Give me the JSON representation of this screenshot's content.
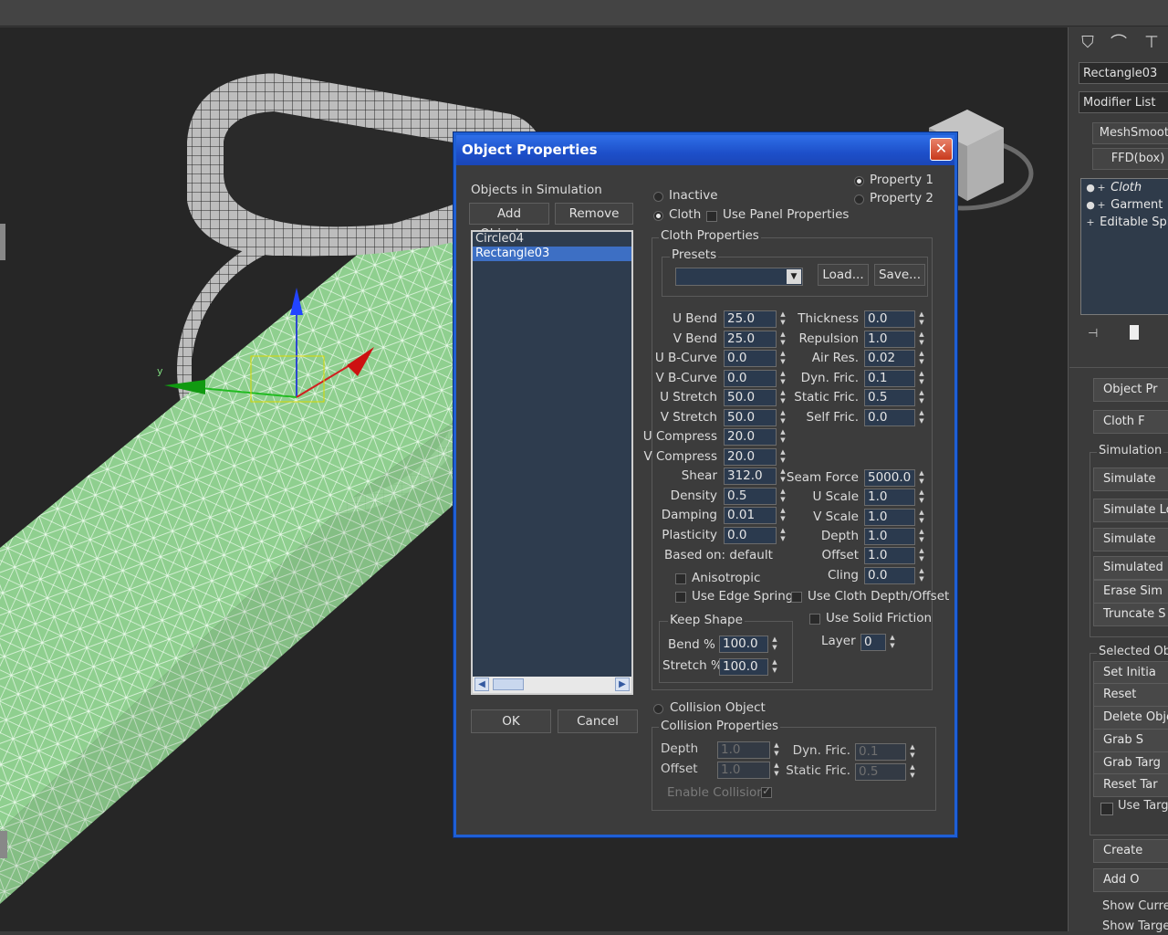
{
  "viewport": {
    "name": "3d-viewport"
  },
  "command_panel": {
    "object_name": "Rectangle03",
    "modifier_list": "Modifier List",
    "buttons": [
      "MeshSmooth",
      "FFD(box)"
    ],
    "stack": [
      {
        "label": "Cloth",
        "icon": "bulb-icon"
      },
      {
        "label": "Garment",
        "icon": "bulb-icon"
      },
      {
        "label": "Editable Spl",
        "icon": "plus-icon"
      }
    ],
    "rollout_top": [
      "Object Pr",
      "Cloth F"
    ],
    "simulation_group": "Simulation",
    "simulation_buttons": [
      "Simulate",
      "Simulate Loc",
      "Simulate",
      "Simulated Fra",
      "Erase Sim",
      "Truncate S"
    ],
    "selected_group": "Selected Obje",
    "selected_buttons": [
      "Set Initia",
      "Reset",
      "Delete Obje",
      "Grab S",
      "Grab Targ",
      "Reset Tar"
    ],
    "use_target_label": "Use Targ",
    "bottom_buttons": [
      "Create",
      "Add O"
    ],
    "bottom_labels": [
      "Show Curren",
      "Show Targe"
    ]
  },
  "dialog": {
    "title": "Object Properties",
    "objects_label": "Objects in Simulation",
    "add_objects": "Add Objects...",
    "remove": "Remove",
    "objects": [
      "Circle04",
      "Rectangle03"
    ],
    "selected_index": 1,
    "ok": "OK",
    "cancel": "Cancel",
    "property1": "Property 1",
    "property2": "Property 2",
    "inactive": "Inactive",
    "cloth": "Cloth",
    "use_panel": "Use Panel Properties",
    "cloth_properties": "Cloth Properties",
    "presets": "Presets",
    "preset_value": "",
    "load": "Load...",
    "save": "Save...",
    "left_params": [
      {
        "label": "U Bend",
        "value": "25.0"
      },
      {
        "label": "V Bend",
        "value": "25.0"
      },
      {
        "label": "U B-Curve",
        "value": "0.0"
      },
      {
        "label": "V B-Curve",
        "value": "0.0"
      },
      {
        "label": "U Stretch",
        "value": "50.0"
      },
      {
        "label": "V Stretch",
        "value": "50.0"
      },
      {
        "label": "U Compress",
        "value": "20.0"
      },
      {
        "label": "V Compress",
        "value": "20.0"
      },
      {
        "label": "Shear",
        "value": "312.0"
      },
      {
        "label": "Density",
        "value": "0.5"
      },
      {
        "label": "Damping",
        "value": "0.01"
      },
      {
        "label": "Plasticity",
        "value": "0.0"
      }
    ],
    "right_params": [
      {
        "label": "Thickness",
        "value": "0.0"
      },
      {
        "label": "Repulsion",
        "value": "1.0"
      },
      {
        "label": "Air Res.",
        "value": "0.02"
      },
      {
        "label": "Dyn. Fric.",
        "value": "0.1"
      },
      {
        "label": "Static Fric.",
        "value": "0.5"
      },
      {
        "label": "Self Fric.",
        "value": "0.0"
      }
    ],
    "right_params2": [
      {
        "label": "Seam Force",
        "value": "5000.0"
      },
      {
        "label": "U Scale",
        "value": "1.0"
      },
      {
        "label": "V Scale",
        "value": "1.0"
      },
      {
        "label": "Depth",
        "value": "1.0"
      },
      {
        "label": "Offset",
        "value": "1.0"
      },
      {
        "label": "Cling",
        "value": "0.0"
      }
    ],
    "based_on": "Based on: default",
    "anisotropic": "Anisotropic",
    "use_edge_springs": "Use Edge Springs",
    "use_cloth_depth": "Use Cloth Depth/Offset",
    "use_solid_friction": "Use Solid Friction",
    "keep_shape": "Keep Shape",
    "bend_pct_label": "Bend %",
    "bend_pct": "100.0",
    "stretch_pct_label": "Stretch %",
    "stretch_pct": "100.0",
    "layer_label": "Layer",
    "layer": "0",
    "collision_object": "Collision Object",
    "collision_properties": "Collision Properties",
    "c_depth_label": "Depth",
    "c_depth": "1.0",
    "c_offset_label": "Offset",
    "c_offset": "1.0",
    "c_dyn_label": "Dyn. Fric.",
    "c_dyn": "0.1",
    "c_static_label": "Static Fric.",
    "c_static": "0.5",
    "enable_collisions": "Enable Collisions"
  }
}
